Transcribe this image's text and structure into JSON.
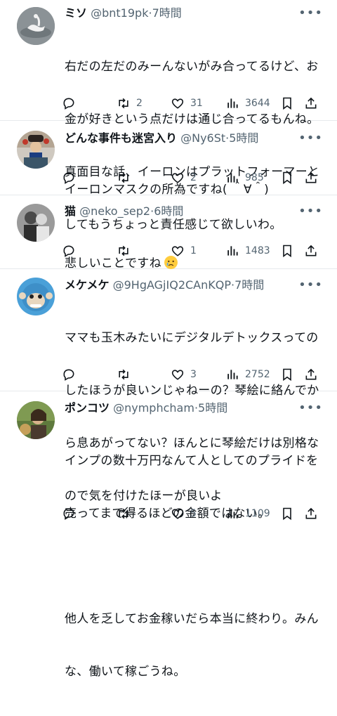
{
  "tweets": [
    {
      "name": "ミソ",
      "handle": "@bnt19pk",
      "dot": "·",
      "time": "7時間",
      "lines": [
        "右だの左だのみーんないがみ合ってるけど、お",
        "金が好きという点だけは通じ合ってるもんね。",
        "真面目な話、イーロンはプラットフォーマーと",
        "してもうちょっと責任感じて欲しいわ。"
      ],
      "replies": "",
      "retweets": "2",
      "likes": "31",
      "views": "3644"
    },
    {
      "name": "どんな事件も迷宮入り",
      "handle": "@Ny6St",
      "dot": "·",
      "time": "5時間",
      "lines": [
        "イーロンマスクの所為ですね( ＾∀＾)"
      ],
      "replies": "",
      "retweets": "",
      "likes": "2",
      "views": "985"
    },
    {
      "name": "猫",
      "handle": "@neko_sep2",
      "dot": "·",
      "time": "6時間",
      "lines": [
        "悲しいことですね"
      ],
      "replies": "",
      "retweets": "",
      "likes": "1",
      "views": "1483"
    },
    {
      "name": "メケメケ",
      "handle": "@9HgAGjIQ2CAnKQP",
      "dot": "·",
      "time": "7時間",
      "lines": [
        "ママも玉木みたいにデジタルデトックスっての",
        "したほうが良いンじゃねーの？琴絵に絡んでか",
        "ら息あがってない？ほんとに琴絵だけは別格な",
        "ので気を付けたほーが良いよ"
      ],
      "replies": "",
      "retweets": "",
      "likes": "3",
      "views": "2752"
    },
    {
      "name": "ポンコツ",
      "handle": "@nymphcham",
      "dot": "·",
      "time": "5時間",
      "lines": [
        "インプの数十万円なんて人としてのプライドを",
        "売ってまで得るほどの金額ではない。",
        "",
        "他人を乏してお金稼いだら本当に終わり。みん",
        "な、働いて稼ごうね。"
      ],
      "replies": "",
      "retweets": "",
      "likes": "5",
      "views": "1109"
    }
  ],
  "icons": {
    "more": "more-icon",
    "reply": "reply-icon",
    "retweet": "retweet-icon",
    "like": "like-icon",
    "views": "views-icon",
    "bookmark": "bookmark-icon",
    "share": "share-icon"
  },
  "colors": {
    "text": "#0f1419",
    "secondary": "#536471",
    "divider": "#e6e9ec",
    "emoji": "#ffd24a"
  }
}
